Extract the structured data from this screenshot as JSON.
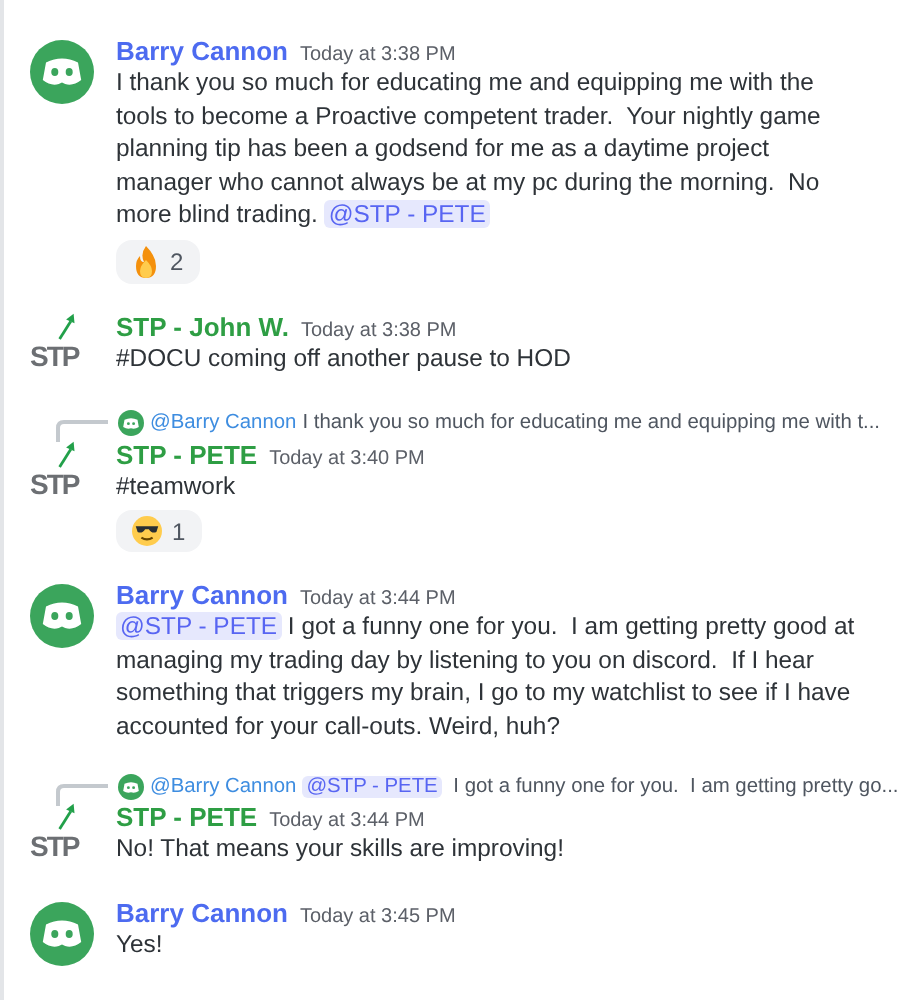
{
  "messages": [
    {
      "author": "Barry Cannon",
      "color": "#4d6bf0",
      "avatar": {
        "kind": "discord"
      },
      "time": "Today at 3:38 PM",
      "content": [
        {
          "kind": "text",
          "text": "I thank you so much for educating me and equipping me with the tools to become a Proactive competent trader.  Your nightly game planning tip has been a godsend for me as a daytime project manager who cannot always be at my pc during the morning.  No more blind trading. "
        },
        {
          "kind": "mention",
          "text": "@STP - PETE"
        }
      ],
      "reactions": [
        {
          "kind": "fire",
          "count": "2"
        }
      ]
    },
    {
      "author": "STP - John W.",
      "color": "#2e9e44",
      "avatar": {
        "kind": "logo",
        "text": "STP"
      },
      "time": "Today at 3:38 PM",
      "content": [
        {
          "kind": "text",
          "text": "#DOCU coming off another pause to HOD"
        }
      ]
    },
    {
      "author": "STP - PETE",
      "color": "#2e9e44",
      "avatar": {
        "kind": "logo",
        "text": "STP"
      },
      "time": "Today at 3:40 PM",
      "reply": {
        "author": "@Barry Cannon",
        "content": [
          {
            "kind": "text",
            "text": "I thank you so much for educating me and equipping me with t..."
          }
        ]
      },
      "content": [
        {
          "kind": "text",
          "text": "#teamwork"
        }
      ],
      "reactions": [
        {
          "kind": "sunglasses",
          "count": "1"
        }
      ]
    },
    {
      "author": "Barry Cannon",
      "color": "#4d6bf0",
      "avatar": {
        "kind": "discord"
      },
      "time": "Today at 3:44 PM",
      "content": [
        {
          "kind": "mention",
          "text": "@STP - PETE"
        },
        {
          "kind": "text",
          "text": " I got a funny one for you.  I am getting pretty good at managing my trading day by listening to you on discord.  If I hear something that triggers my brain, I go to my watchlist to see if I have accounted for your call-outs. Weird, huh?"
        }
      ]
    },
    {
      "author": "STP - PETE",
      "color": "#2e9e44",
      "avatar": {
        "kind": "logo",
        "text": "STP"
      },
      "time": "Today at 3:44 PM",
      "reply": {
        "author": "@Barry Cannon",
        "content": [
          {
            "kind": "mention",
            "text": "@STP - PETE"
          },
          {
            "kind": "text",
            "text": " I got a funny one for you.  I am getting pretty go..."
          }
        ]
      },
      "content": [
        {
          "kind": "text",
          "text": "No! That means your skills are improving!"
        }
      ]
    },
    {
      "author": "Barry Cannon",
      "color": "#4d6bf0",
      "avatar": {
        "kind": "discord"
      },
      "time": "Today at 3:45 PM",
      "content": [
        {
          "kind": "text",
          "text": "Yes!"
        }
      ]
    }
  ]
}
